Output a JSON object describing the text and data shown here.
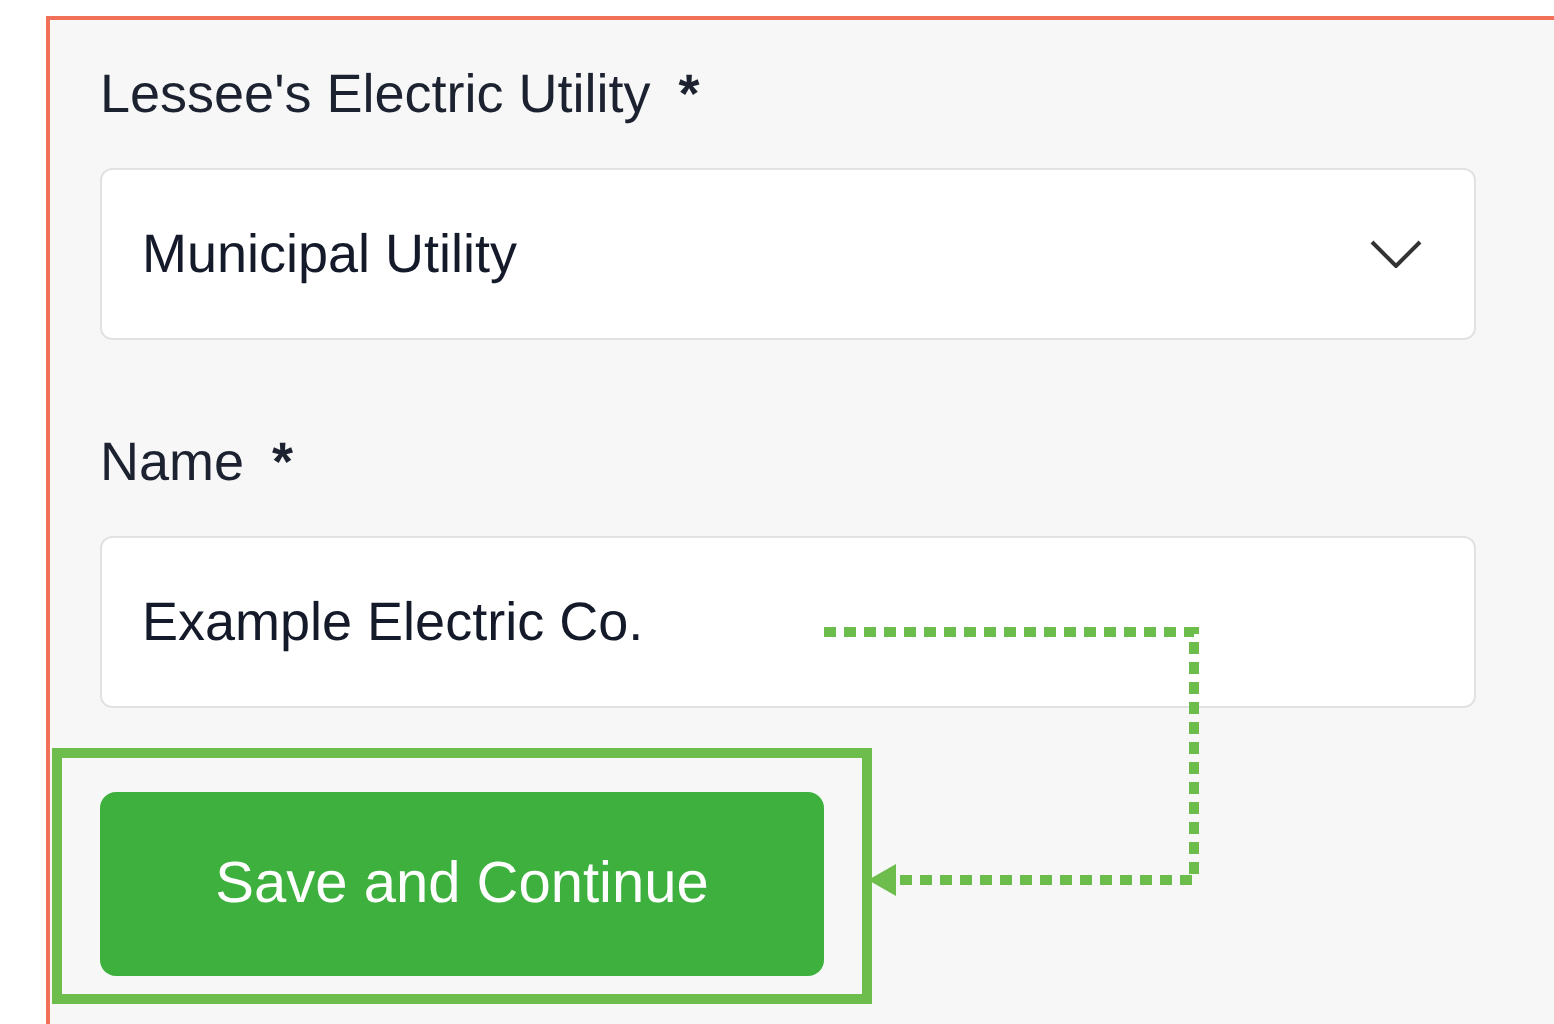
{
  "fields": [
    {
      "kind": "select",
      "label": "Lessee's Electric Utility",
      "required_mark": "*",
      "value": "Municipal Utility"
    },
    {
      "kind": "text",
      "label": "Name",
      "required_mark": "*",
      "value": "Example Electric Co."
    }
  ],
  "submit_button": {
    "label": "Save and Continue",
    "highlighted": true
  }
}
